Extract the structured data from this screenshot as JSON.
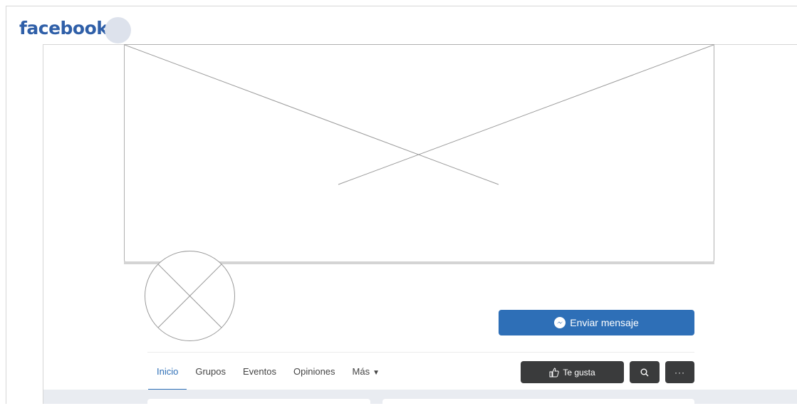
{
  "header": {
    "logo_text": "facebook"
  },
  "profile": {
    "send_message_label": "Enviar mensaje"
  },
  "nav": {
    "tabs": [
      {
        "label": "Inicio",
        "active": true
      },
      {
        "label": "Grupos",
        "active": false
      },
      {
        "label": "Eventos",
        "active": false
      },
      {
        "label": "Opiniones",
        "active": false
      },
      {
        "label": "Más",
        "active": false
      }
    ]
  },
  "actions": {
    "like_label": "Te gusta",
    "search_icon": "search-icon",
    "more_label": "···"
  },
  "colors": {
    "brand_blue": "#2e6fb7",
    "dark_button": "#3a3b3c",
    "strip": "#e9ecf1"
  }
}
